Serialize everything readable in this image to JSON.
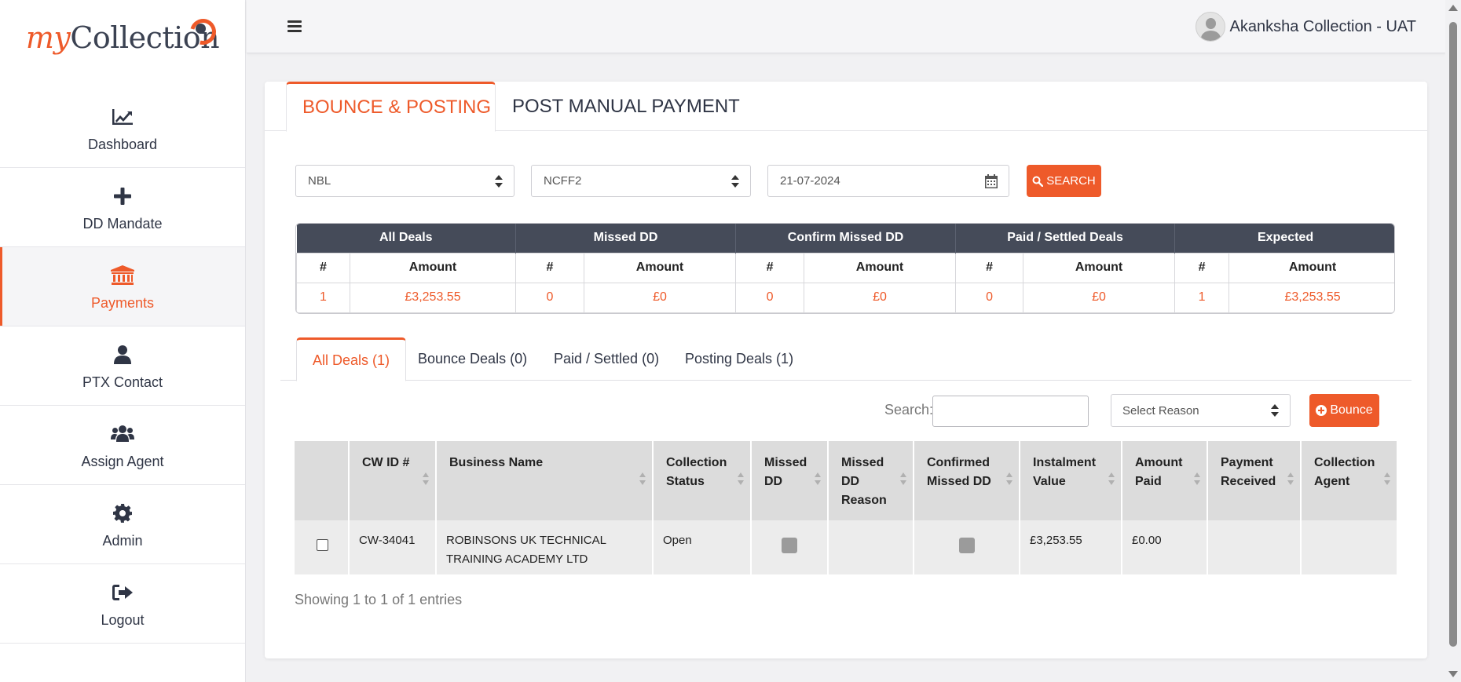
{
  "app": {
    "logo_my": "my",
    "logo_collection": "Collection",
    "user_name": "Akanksha Collection - UAT"
  },
  "sidebar": {
    "items": [
      {
        "label": "Dashboard",
        "icon": "chart-line-icon"
      },
      {
        "label": "DD Mandate",
        "icon": "plus-icon"
      },
      {
        "label": "Payments",
        "icon": "bank-icon",
        "active": true
      },
      {
        "label": "PTX Contact",
        "icon": "user-icon"
      },
      {
        "label": "Assign Agent",
        "icon": "users-icon"
      },
      {
        "label": "Admin",
        "icon": "gear-icon"
      },
      {
        "label": "Logout",
        "icon": "sign-out-icon"
      }
    ]
  },
  "tabs": {
    "bounce_posting": "BOUNCE & POSTING",
    "manual_payment": "POST MANUAL PAYMENT"
  },
  "filters": {
    "lender": "NBL",
    "product": "NCFF2",
    "date": "21-07-2024",
    "search_label": "SEARCH"
  },
  "summary": {
    "groups": [
      "All Deals",
      "Missed DD",
      "Confirm Missed DD",
      "Paid / Settled Deals",
      "Expected"
    ],
    "count_header": "#",
    "amount_header": "Amount",
    "values": [
      {
        "count": "1",
        "amount": "£3,253.55"
      },
      {
        "count": "0",
        "amount": "£0"
      },
      {
        "count": "0",
        "amount": "£0"
      },
      {
        "count": "0",
        "amount": "£0"
      },
      {
        "count": "1",
        "amount": "£3,253.55"
      }
    ]
  },
  "sub_tabs": [
    "All Deals (1)",
    "Bounce Deals (0)",
    "Paid / Settled (0)",
    "Posting Deals (1)"
  ],
  "toolbar": {
    "search_label": "Search:",
    "search_value": "",
    "reason_placeholder": "Select Reason",
    "bounce_label": "Bounce"
  },
  "table": {
    "headers": [
      "CW ID #",
      "Business Name",
      "Collection Status",
      "Missed DD",
      "Missed DD Reason",
      "Confirmed Missed DD",
      "Instalment Value",
      "Amount Paid",
      "Payment Received",
      "Collection Agent"
    ],
    "rows": [
      {
        "cw_id": "CW-34041",
        "business_name": "ROBINSONS UK TECHNICAL TRAINING ACADEMY LTD",
        "status": "Open",
        "missed_dd_reason": "",
        "instalment_value": "£3,253.55",
        "amount_paid": "£0.00",
        "payment_received": "",
        "collection_agent": ""
      }
    ],
    "footer": "Showing 1 to 1 of 1 entries"
  },
  "colors": {
    "accent": "#ee5a2a",
    "header_dark": "#454b59",
    "text_dark": "#2f3545"
  }
}
